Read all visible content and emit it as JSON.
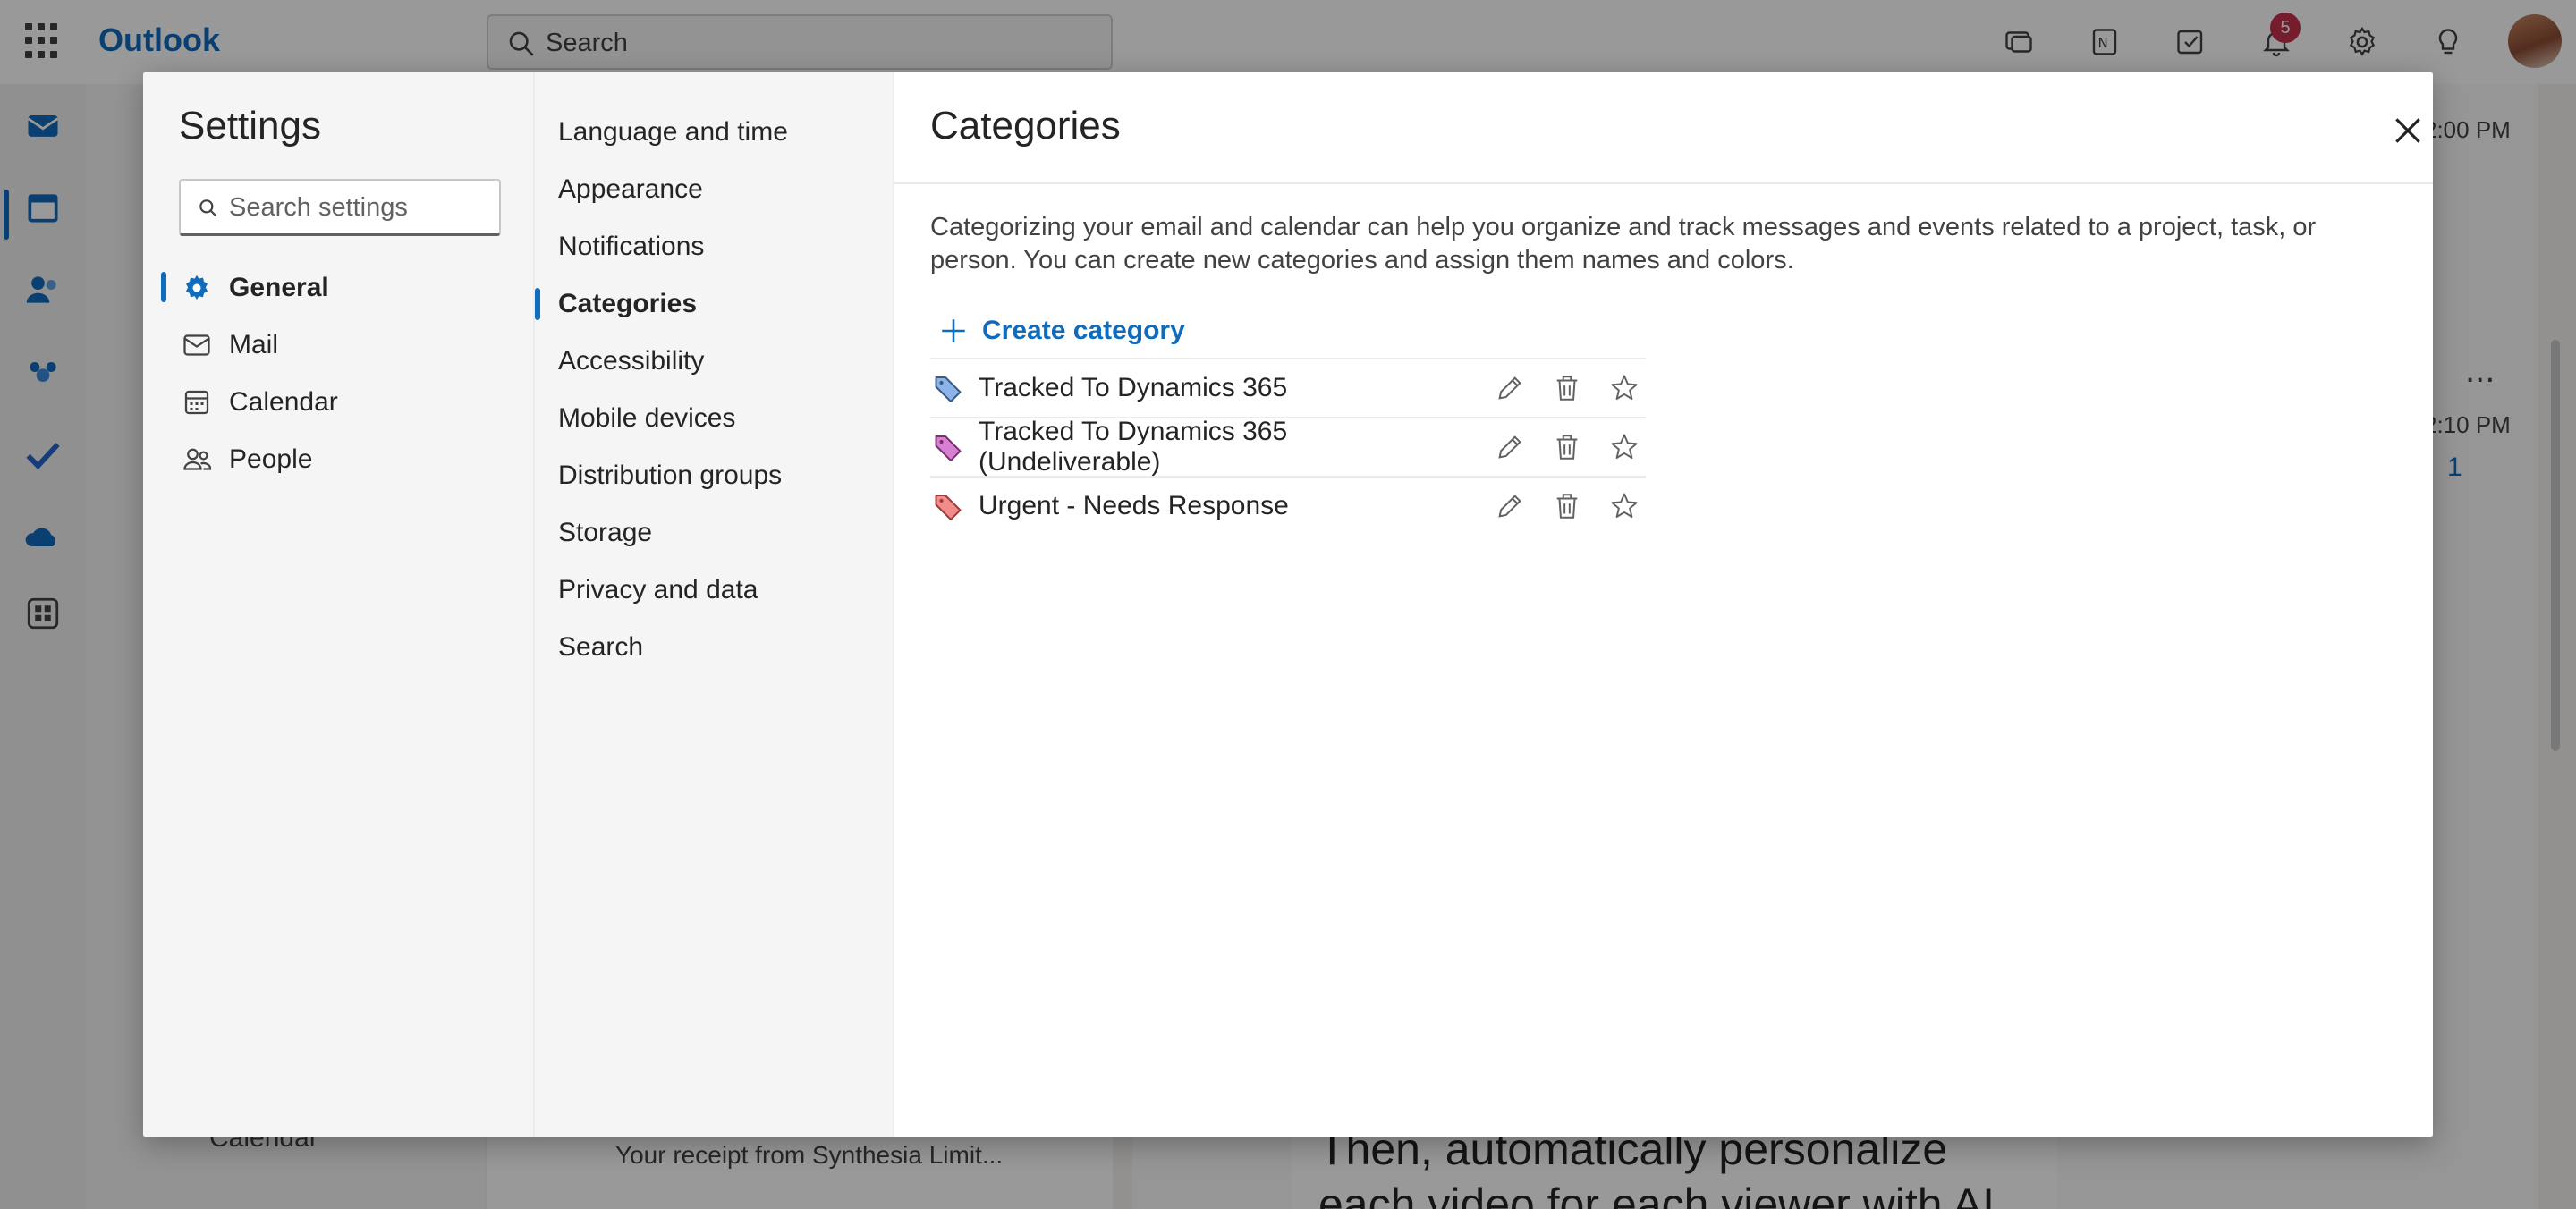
{
  "app": {
    "name": "Outlook"
  },
  "search": {
    "placeholder": "Search"
  },
  "topbar": {
    "notification_count": "5"
  },
  "background": {
    "time_top": "2:00 PM",
    "time_item": "2:10 PM",
    "reaction_count": "1",
    "more": "...",
    "receipt_subject": "Your receipt from Synthesia Limit...",
    "folder_calendar": "Calendar",
    "promo_text": "Then, automatically personalize each video for each viewer with AI"
  },
  "settings": {
    "title": "Settings",
    "search_placeholder": "Search settings",
    "sections": [
      {
        "label": "General",
        "icon": "gear-icon",
        "active": true
      },
      {
        "label": "Mail",
        "icon": "mail-icon",
        "active": false
      },
      {
        "label": "Calendar",
        "icon": "calendar-icon",
        "active": false
      },
      {
        "label": "People",
        "icon": "people-icon",
        "active": false
      }
    ],
    "subsections": [
      {
        "label": "Language and time",
        "active": false
      },
      {
        "label": "Appearance",
        "active": false
      },
      {
        "label": "Notifications",
        "active": false
      },
      {
        "label": "Categories",
        "active": true
      },
      {
        "label": "Accessibility",
        "active": false
      },
      {
        "label": "Mobile devices",
        "active": false
      },
      {
        "label": "Distribution groups",
        "active": false
      },
      {
        "label": "Storage",
        "active": false
      },
      {
        "label": "Privacy and data",
        "active": false
      },
      {
        "label": "Search",
        "active": false
      }
    ]
  },
  "categories": {
    "title": "Categories",
    "description": "Categorizing your email and calendar can help you organize and track messages and events related to a project, task, or person. You can create new categories and assign them names and colors.",
    "create_label": "Create category",
    "items": [
      {
        "name": "Tracked To Dynamics 365",
        "color": "#8cb4e8"
      },
      {
        "name": "Tracked To Dynamics 365 (Undeliverable)",
        "color": "#d77fd0"
      },
      {
        "name": "Urgent - Needs Response",
        "color": "#f08c8c"
      }
    ]
  },
  "colors": {
    "accent": "#0f6cbd",
    "badge": "#c4314b"
  }
}
